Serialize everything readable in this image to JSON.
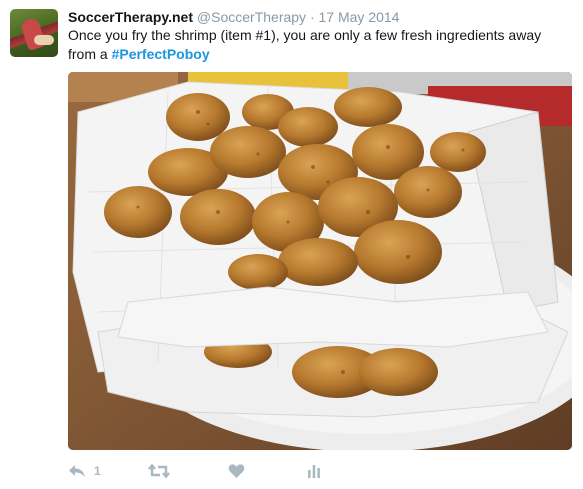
{
  "tweet": {
    "display_name": "SoccerTherapy.net",
    "handle": "@SoccerTherapy",
    "separator": "·",
    "date": "17 May 2014",
    "text_line1": "Once you fry the shrimp (item #1), you are only a few fresh ingredients away",
    "text_line2_prefix": "from a ",
    "hashtag": "#PerfectPoboy"
  },
  "media": {
    "description_icon": "photo-of-fried-shrimp",
    "colors": {
      "table": "#7d5a3a",
      "plate": "#f2f2f2",
      "paper_towel": "#f7f7f7",
      "shrimp": "#b97a2e"
    }
  },
  "actions": {
    "reply_icon": "reply-icon",
    "reply_count": "1",
    "retweet_icon": "retweet-icon",
    "like_icon": "heart-icon",
    "analytics_icon": "analytics-icon"
  },
  "colors": {
    "text": "#14171a",
    "muted": "#8899a6",
    "hashtag": "#1b95e0",
    "action_icons": "#aab8c2"
  }
}
